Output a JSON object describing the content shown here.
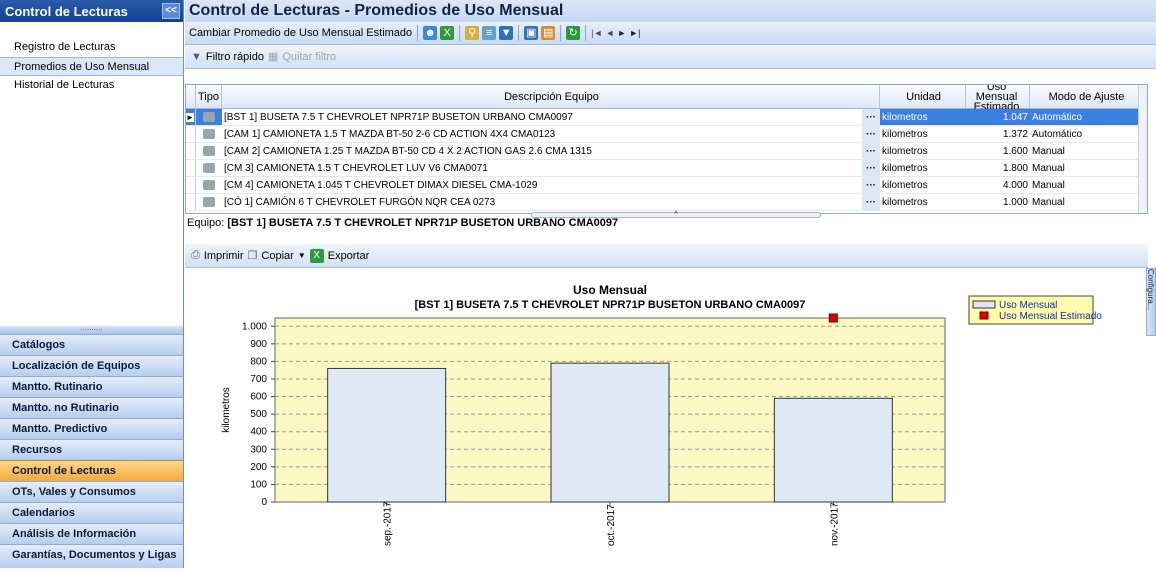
{
  "sidebar": {
    "title": "Control de Lecturas",
    "collapse": "<<",
    "items": [
      {
        "label": "Registro de Lecturas"
      },
      {
        "label": "Promedios de Uso Mensual"
      },
      {
        "label": "Historial de Lecturas"
      }
    ],
    "sections": [
      "Catálogos",
      "Localización de Equipos",
      "Mantto. Rutinario",
      "Mantto. no Rutinario",
      "Mantto. Predictivo",
      "Recursos",
      "Control de Lecturas",
      "OTs, Vales y Consumos",
      "Calendarios",
      "Análisis de Información",
      "Garantías, Documentos y Ligas"
    ]
  },
  "main": {
    "title": "Control de Lecturas - Promedios de Uso Mensual",
    "toolbar_label": "Cambiar Promedio de Uso Mensual Estimado",
    "filter_quick": "Filtro rápido",
    "filter_remove": "Quitar filtro",
    "print": "Imprimir",
    "copy": "Copiar",
    "export": "Exportar",
    "equipo_label": "Equipo:",
    "equipo_value": "[BST 1] BUSETA 7.5 T CHEVROLET NPR71P BUSETON URBANO CMA0097"
  },
  "grid": {
    "headers": {
      "tipo": "Tipo",
      "desc": "Descripción Equipo",
      "unidad": "Unidad",
      "uso": "Uso Mensual Estimado",
      "modo": "Modo de Ajuste"
    },
    "rows": [
      {
        "desc": "[BST 1] BUSETA 7.5 T CHEVROLET NPR71P BUSETON URBANO CMA0097",
        "unidad": "kilometros",
        "uso": "1.047",
        "modo": "Automático"
      },
      {
        "desc": "[CAM 1] CAMIONETA 1.5 T MAZDA BT-50 2-6 CD ACTION 4X4 CMA0123",
        "unidad": "kilometros",
        "uso": "1.372",
        "modo": "Automático"
      },
      {
        "desc": "[CAM 2] CAMIONETA 1.25 T MAZDA BT-50 CD  4 X 2 ACTION GAS  2.6 CMA 1315",
        "unidad": "kilometros",
        "uso": "1.600",
        "modo": "Manual"
      },
      {
        "desc": "[CM 3] CAMIONETA 1.5 T CHEVROLET LUV  V6 CMA0071",
        "unidad": "kilometros",
        "uso": "1.800",
        "modo": "Manual"
      },
      {
        "desc": "[CM 4] CAMIONETA 1.045 T CHEVROLET DIMAX DIESEL CMA-1029",
        "unidad": "kilometros",
        "uso": "4.000",
        "modo": "Manual"
      },
      {
        "desc": "[CÓ 1] CAMIÓN 6 T CHEVROLET FURGÓN  NQR CEA 0273",
        "unidad": "kilometros",
        "uso": "1.000",
        "modo": "Manual"
      }
    ]
  },
  "chart_data": {
    "type": "bar",
    "title": "Uso Mensual",
    "subtitle": "[BST 1] BUSETA 7.5 T CHEVROLET NPR71P BUSETON URBANO CMA0097",
    "categories": [
      "sep.-2017",
      "oct.-2017",
      "nov.-2017"
    ],
    "series": [
      {
        "name": "Uso Mensual",
        "values": [
          760,
          790,
          590
        ],
        "color": "#dfe8f5"
      },
      {
        "name": "Uso Mensual Estimado",
        "values": [
          null,
          null,
          1047
        ],
        "color": "#e00000"
      }
    ],
    "ylabel": "kilometros",
    "ylim": [
      0,
      1047
    ],
    "yticks": [
      "0",
      "100",
      "200",
      "300",
      "400",
      "500",
      "600",
      "700",
      "800",
      "900",
      "1.000"
    ],
    "grid": true,
    "legend": "top-right",
    "plot_bg": "#fbf8c4"
  },
  "side_tab": "Configura..."
}
